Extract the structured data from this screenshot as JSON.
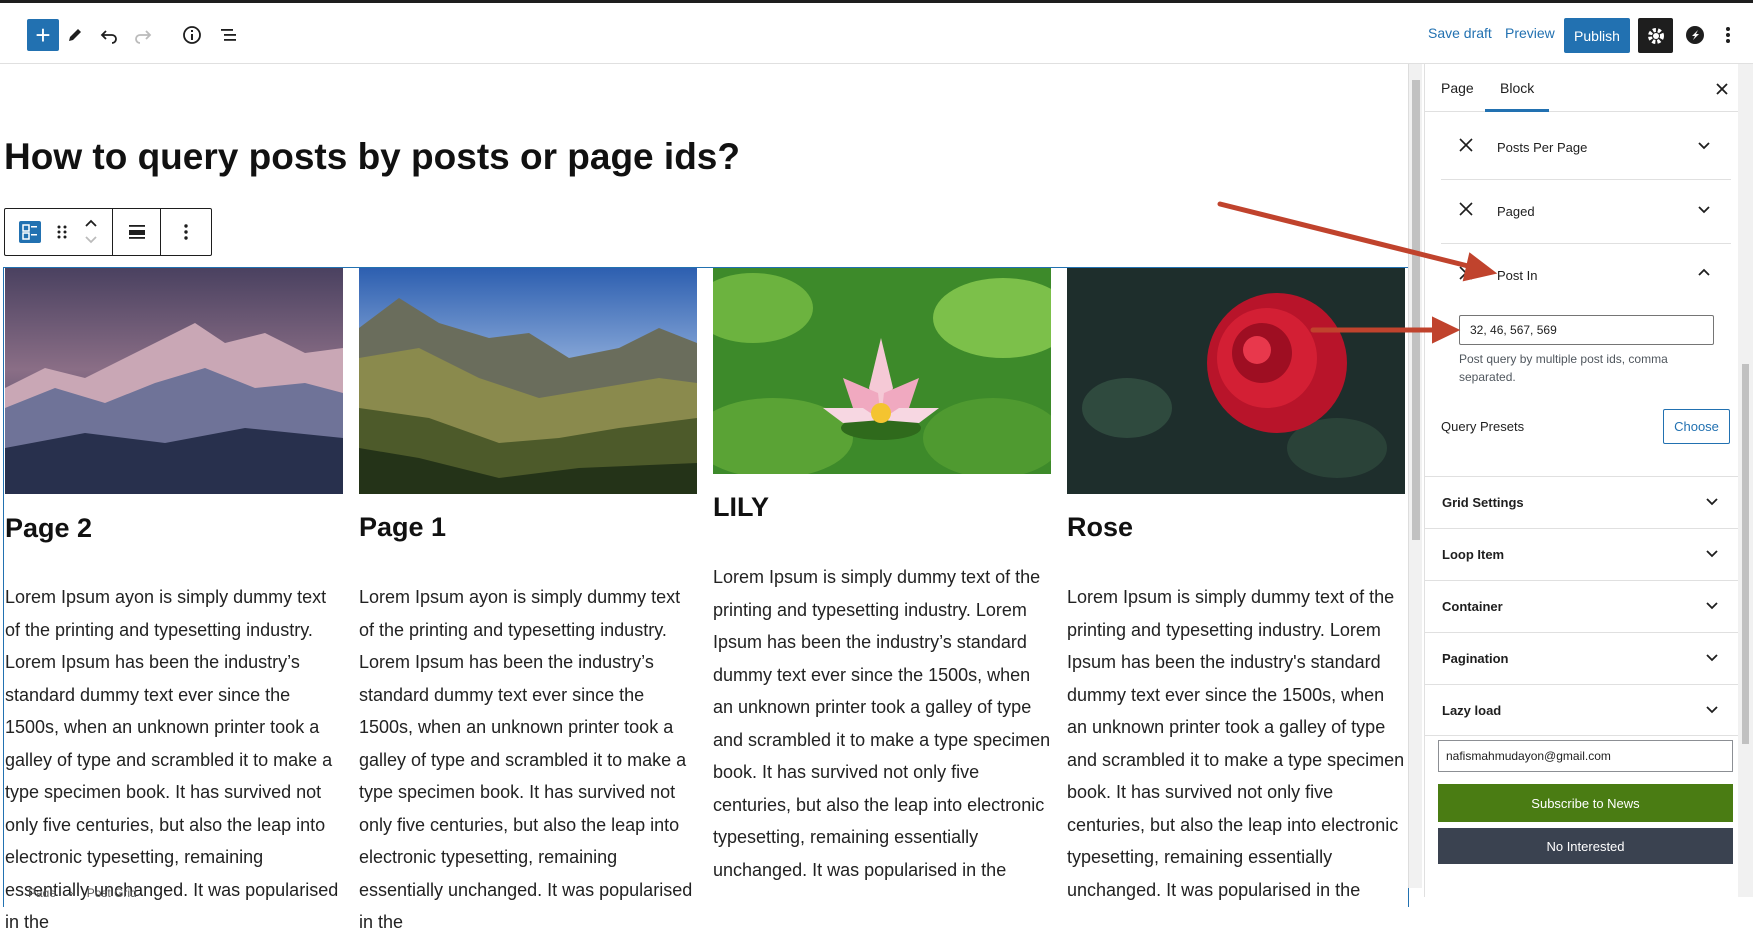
{
  "toolbar": {
    "add_label": "+",
    "save_draft": "Save draft",
    "preview": "Preview",
    "publish": "Publish"
  },
  "page": {
    "title": "How to query posts by posts or page ids?"
  },
  "cards": [
    {
      "title": "Page 2",
      "text": "Lorem Ipsum ayon is simply dummy text of the printing and typesetting industry. Lorem Ipsum has been the industry’s standard dummy text ever since the 1500s, when an unknown printer took a galley of type and scrambled it to make a type specimen book. It has survived not only five centuries, but also the leap into electronic typesetting, remaining essentially unchanged. It was popularised in the"
    },
    {
      "title": "Page 1",
      "text": "Lorem Ipsum ayon is simply dummy text of the printing and typesetting industry. Lorem Ipsum has been the industry’s standard dummy text ever since the 1500s, when an unknown printer took a galley of type and scrambled it to make a type specimen book. It has survived not only five centuries, but also the leap into electronic typesetting, remaining essentially unchanged. It was popularised in the"
    },
    {
      "title": "LILY",
      "text": "Lorem Ipsum is simply dummy text of the printing and typesetting industry. Lorem Ipsum has been the industry’s standard dummy text ever since the 1500s, when an unknown printer took a galley of type and scrambled it to make a type specimen book. It has survived not only five centuries, but also the leap into electronic typesetting, remaining essentially unchanged. It was popularised in the"
    },
    {
      "title": "Rose",
      "text": "Lorem Ipsum is simply dummy text of the printing and typesetting industry. Lorem Ipsum has been the industry's standard dummy text ever since the 1500s, when an unknown printer took a galley of type and scrambled it to make a type specimen book. It has survived not only five centuries, but also the leap into electronic typesetting, remaining essentially unchanged. It was popularised in the"
    }
  ],
  "breadcrumb": {
    "items": [
      "Page",
      "Post Grid"
    ],
    "separator": "›"
  },
  "sidebar": {
    "tabs": [
      "Page",
      "Block"
    ],
    "active_tab": "Block",
    "query_args": [
      "Posts Per Page",
      "Paged",
      "Post In"
    ],
    "post_in_value": "32, 46, 567, 569",
    "post_in_help": "Post query by multiple post ids, comma separated.",
    "query_presets_label": "Query Presets",
    "choose_label": "Choose",
    "panels": [
      "Grid Settings",
      "Loop Item",
      "Container",
      "Pagination",
      "Lazy load"
    ],
    "email_value": "nafismahmudayon@gmail.com",
    "subscribe_label": "Subscribe to News",
    "no_interest_label": "No Interested"
  },
  "colors": {
    "accent": "#2271b1",
    "annotation_arrow": "#c0432d",
    "subscribe_bg": "#4a7c13",
    "no_interest_bg": "#3a4250"
  }
}
